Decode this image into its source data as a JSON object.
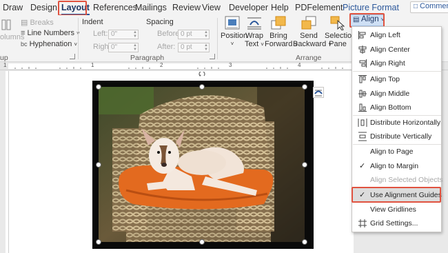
{
  "tabs": {
    "draw": "Draw",
    "design": "Design",
    "layout": "Layout",
    "references": "References",
    "mailings": "Mailings",
    "review": "Review",
    "view": "View",
    "developer": "Developer",
    "help": "Help",
    "pdfelement": "PDFelement",
    "picture_format": "Picture Format"
  },
  "comments_label": "Commen",
  "page_setup": {
    "columns": "olumns",
    "breaks": "Breaks",
    "line_numbers": "Line Numbers",
    "hyphenation": "Hyphenation",
    "group_label": "up"
  },
  "paragraph": {
    "indent_label": "Indent",
    "spacing_label": "Spacing",
    "left_label": "Left:",
    "right_label": "Right:",
    "before_label": "Before:",
    "after_label": "After:",
    "left_value": "0\"",
    "right_value": "0\"",
    "before_value": "0 pt",
    "after_value": "0 pt",
    "group_label": "Paragraph"
  },
  "arrange": {
    "position": "Position",
    "wrap_text_1": "Wrap",
    "wrap_text_2": "Text",
    "bring_forward_1": "Bring",
    "bring_forward_2": "Forward",
    "send_backward_1": "Send",
    "send_backward_2": "Backward",
    "selection_pane_1": "Selection",
    "selection_pane_2": "Pane",
    "align": "Align",
    "group_label": "Arrange"
  },
  "ruler_numbers": [
    "1",
    "1",
    "2",
    "3",
    "4"
  ],
  "align_menu": [
    {
      "label": "Align Left",
      "icon": "align-left-icon",
      "enabled": true
    },
    {
      "label": "Align Center",
      "icon": "align-center-icon",
      "enabled": true
    },
    {
      "label": "Align Right",
      "icon": "align-right-icon",
      "enabled": true
    },
    {
      "label": "Align Top",
      "icon": "align-top-icon",
      "enabled": true
    },
    {
      "label": "Align Middle",
      "icon": "align-middle-icon",
      "enabled": true
    },
    {
      "label": "Align Bottom",
      "icon": "align-bottom-icon",
      "enabled": true
    },
    {
      "label": "Distribute Horizontally",
      "icon": "distribute-horizontally-icon",
      "enabled": true
    },
    {
      "label": "Distribute Vertically",
      "icon": "distribute-vertically-icon",
      "enabled": true
    },
    {
      "label": "Align to Page",
      "icon": "",
      "enabled": true
    },
    {
      "label": "Align to Margin",
      "icon": "checkmark-icon",
      "enabled": true,
      "checked": true
    },
    {
      "label": "Align Selected Objects",
      "icon": "",
      "enabled": false
    },
    {
      "label": "Use Alignment Guides",
      "icon": "checkmark-icon",
      "enabled": true,
      "checked": true,
      "highlighted": true
    },
    {
      "label": "View Gridlines",
      "icon": "",
      "enabled": true
    },
    {
      "label": "Grid Settings...",
      "icon": "grid-icon",
      "enabled": true
    }
  ],
  "colors": {
    "accent": "#2b579a",
    "highlight_box": "#e0523f",
    "ribbon_bg": "#f3f3f3",
    "cushion": "#e36a1f"
  }
}
